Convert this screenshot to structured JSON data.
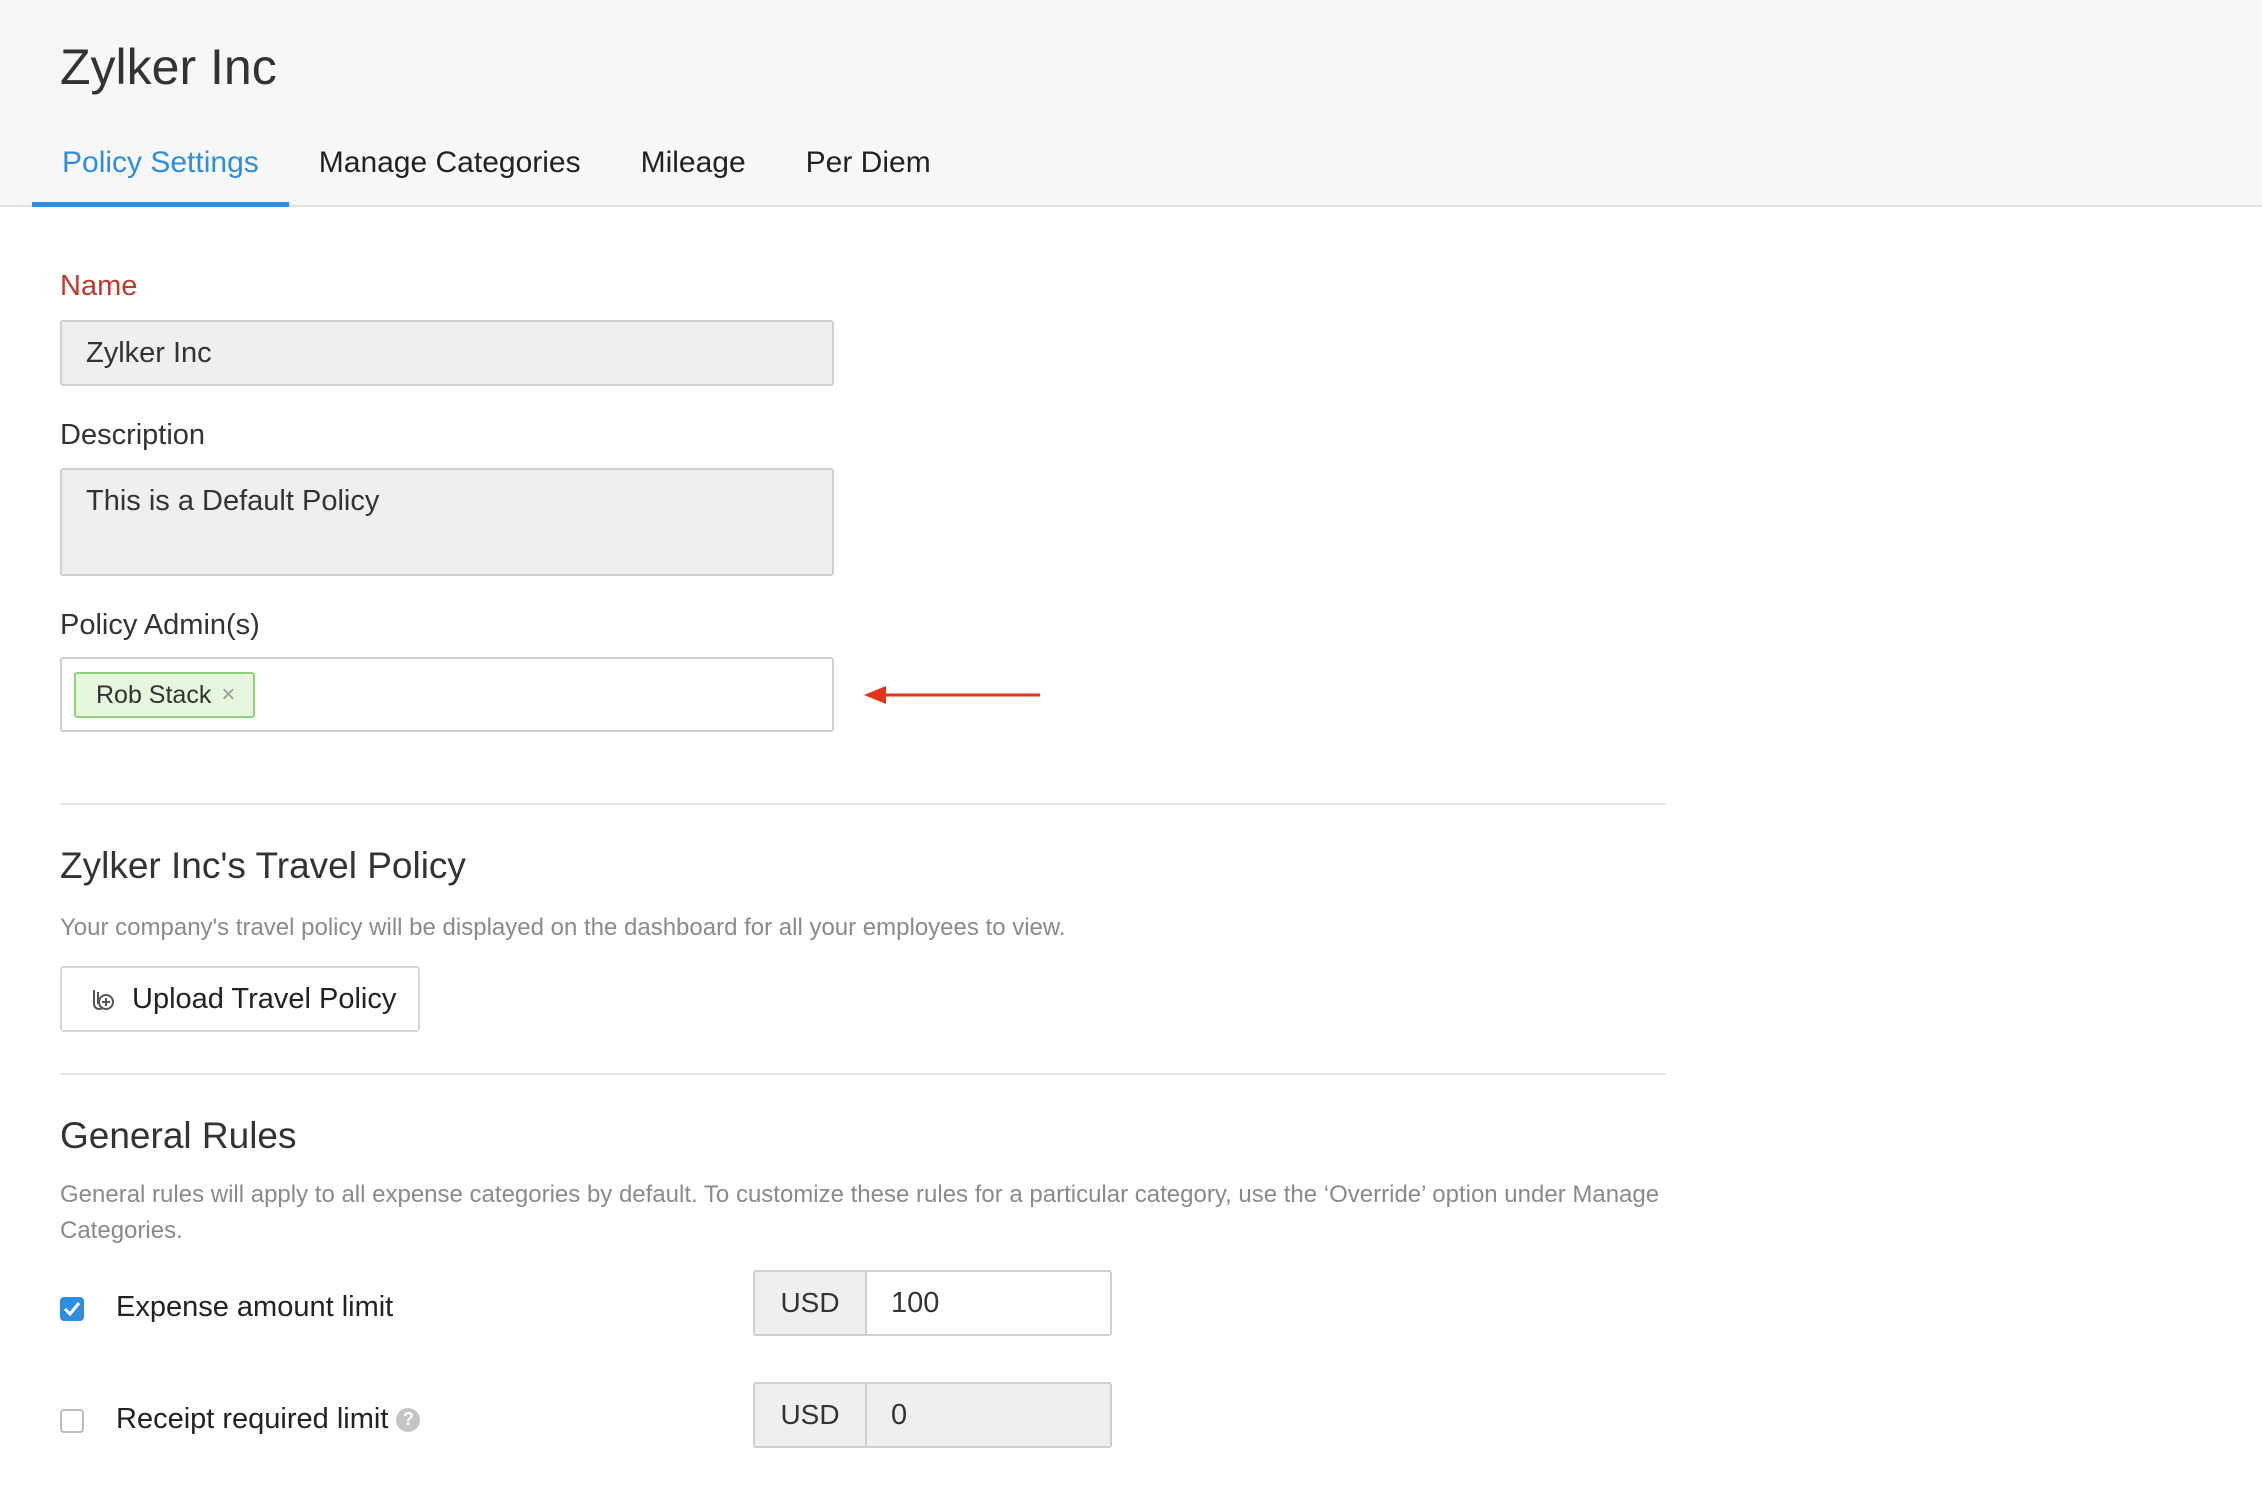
{
  "header": {
    "org_title": "Zylker Inc",
    "tabs": [
      {
        "label": "Policy Settings",
        "active": true
      },
      {
        "label": "Manage Categories",
        "active": false
      },
      {
        "label": "Mileage",
        "active": false
      },
      {
        "label": "Per Diem",
        "active": false
      }
    ]
  },
  "form": {
    "name_label": "Name",
    "name_value": "Zylker Inc",
    "description_label": "Description",
    "description_value": "This is a Default Policy",
    "admins_label": "Policy Admin(s)",
    "admins": [
      {
        "name": "Rob Stack",
        "remove_glyph": "×"
      }
    ]
  },
  "travel_policy": {
    "title": "Zylker Inc's Travel Policy",
    "description": "Your company's travel policy will be displayed on the dashboard for all your employees to view.",
    "upload_label": "Upload Travel Policy",
    "upload_icon": "attachment-add-icon"
  },
  "general_rules": {
    "title": "General Rules",
    "description": "General rules will apply to all expense categories by default. To customize these rules for a particular category, use the ‘Override’ option under Manage Categories.",
    "rules": [
      {
        "label": "Expense amount limit",
        "checked": true,
        "currency": "USD",
        "amount": "100"
      },
      {
        "label": "Receipt required limit",
        "checked": false,
        "currency": "USD",
        "amount": "0",
        "help_icon": "?"
      }
    ]
  },
  "colors": {
    "accent": "#2d8ee0",
    "required_label": "#c0392b",
    "chip_bg": "#e6f6df",
    "annotation_arrow": "#e8311a"
  }
}
